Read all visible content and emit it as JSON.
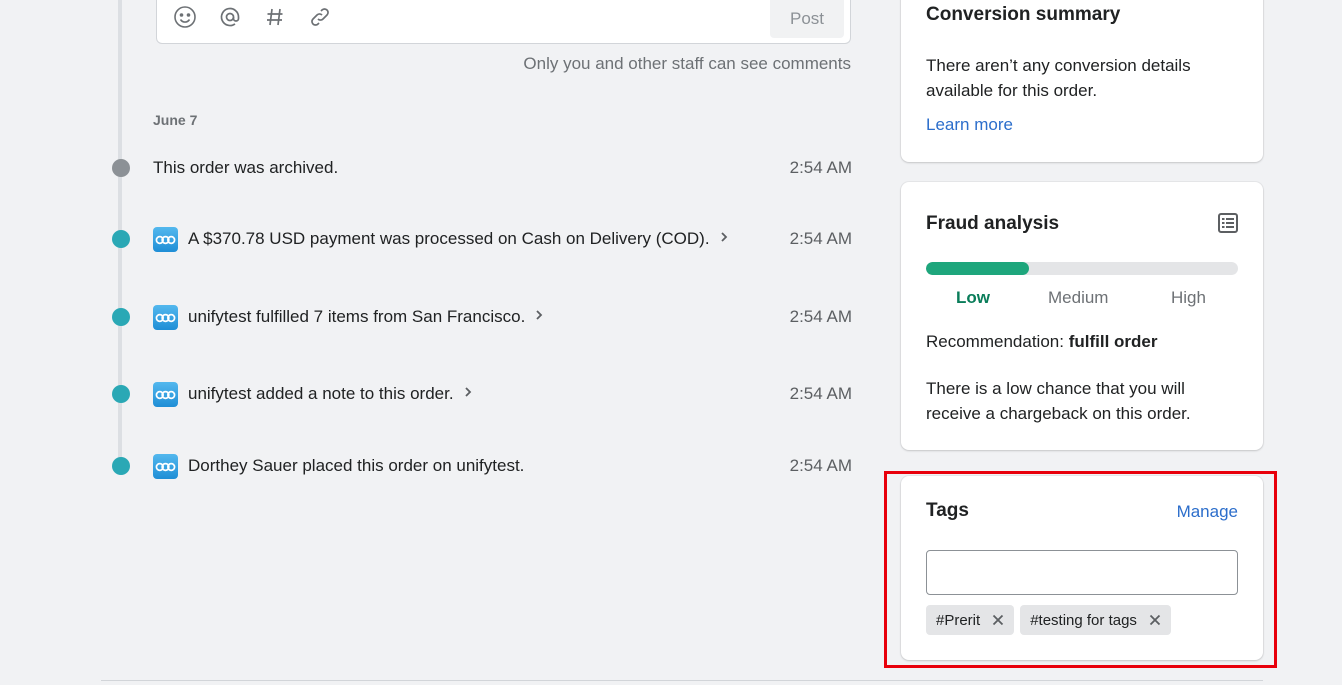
{
  "comment_box": {
    "post_label": "Post",
    "staff_note": "Only you and other staff can see comments",
    "tools": [
      "emoji-icon",
      "mention-icon",
      "hashtag-icon",
      "attachment-icon"
    ]
  },
  "timeline": {
    "date_heading": "June 7",
    "events": [
      {
        "text": "This order was archived.",
        "time": "2:54 AM",
        "dot": "gray",
        "has_logo": false,
        "expandable": false
      },
      {
        "text": "A $370.78 USD payment was processed on Cash on Delivery (COD).",
        "time": "2:54 AM",
        "dot": "teal",
        "has_logo": true,
        "expandable": true
      },
      {
        "text": "unifytest fulfilled 7 items from San Francisco.",
        "time": "2:54 AM",
        "dot": "teal",
        "has_logo": true,
        "expandable": true
      },
      {
        "text": "unifytest added a note to this order.",
        "time": "2:54 AM",
        "dot": "teal",
        "has_logo": true,
        "expandable": true
      },
      {
        "text": "Dorthey Sauer placed this order on unifytest.",
        "time": "2:54 AM",
        "dot": "teal",
        "has_logo": true,
        "expandable": false
      }
    ]
  },
  "conversion": {
    "title": "Conversion summary",
    "body": "There aren’t any conversion details available for this order.",
    "link": "Learn more"
  },
  "fraud": {
    "title": "Fraud analysis",
    "risk_level": 0.33,
    "risk_color": "#1ea67c",
    "levels": [
      "Low",
      "Medium",
      "High"
    ],
    "active_level": "Low",
    "recommendation_label": "Recommendation:",
    "recommendation_value": "fulfill order",
    "description": "There is a low chance that you will receive a chargeback on this order."
  },
  "tags": {
    "title": "Tags",
    "manage_label": "Manage",
    "input_value": "",
    "items": [
      "#Prerit",
      "#testing for tags"
    ]
  },
  "colors": {
    "highlight": "#e8000b",
    "link": "#2c6ecb",
    "teal_dot": "#2aa8b5"
  }
}
